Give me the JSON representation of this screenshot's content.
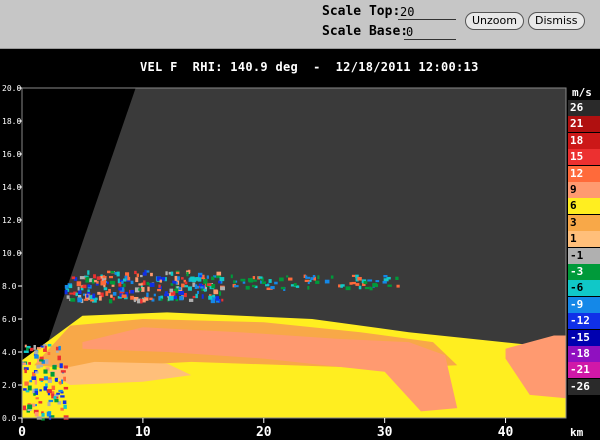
{
  "toolbar": {
    "scale_top_label": "Scale Top:",
    "scale_top_value": "20",
    "scale_base_label": "Scale Base:",
    "scale_base_value": "0",
    "unzoom_label": "Unzoom",
    "dismiss_label": "Dismiss"
  },
  "title": "VEL F  RHI: 140.9 deg  -  12/18/2011 12:00:13",
  "chart_data": {
    "type": "heatmap",
    "product": "VEL F",
    "scan": "RHI",
    "azimuth_deg": 140.9,
    "timestamp": "12/18/2011 12:00:13",
    "xlabel": "km",
    "xlim": [
      0,
      45
    ],
    "ylim": [
      0,
      20
    ],
    "x_ticks": [
      "0",
      "10",
      "20",
      "30",
      "40"
    ],
    "y_ticks": [
      "0.0",
      "2.0",
      "4.0",
      "6.0",
      "8.0",
      "10.0",
      "12.0",
      "14.0",
      "16.0",
      "18.0",
      "20.0"
    ],
    "colorbar_unit": "m/s",
    "colorbar": [
      {
        "label": "26",
        "color": "#2a2a2a"
      },
      {
        "label": "21",
        "color": "#b01010"
      },
      {
        "label": "18",
        "color": "#cc1818"
      },
      {
        "label": "15",
        "color": "#ec3030"
      },
      {
        "label": "12",
        "color": "#ff6a3a"
      },
      {
        "label": "9",
        "color": "#ff9a70"
      },
      {
        "label": "6",
        "color": "#ffee20"
      },
      {
        "label": "3",
        "color": "#f8a848"
      },
      {
        "label": "1",
        "color": "#ffbf7a"
      },
      {
        "label": "-1",
        "color": "#b0b0b0"
      },
      {
        "label": "-3",
        "color": "#009a3a"
      },
      {
        "label": "-6",
        "color": "#10c8c8"
      },
      {
        "label": "-9",
        "color": "#1488e8"
      },
      {
        "label": "-12",
        "color": "#1030e8"
      },
      {
        "label": "-15",
        "color": "#0000b0"
      },
      {
        "label": "-18",
        "color": "#9010c0"
      },
      {
        "label": "-21",
        "color": "#d018a8"
      },
      {
        "label": "-26",
        "color": "#2a2a2a"
      }
    ]
  }
}
